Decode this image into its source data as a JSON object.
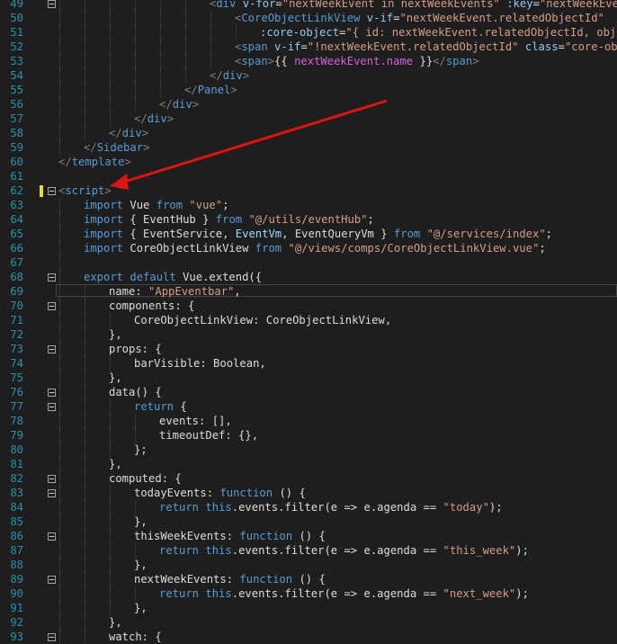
{
  "editor": {
    "language": "vue",
    "modified_line": 62,
    "current_line": 69,
    "lines": [
      {
        "n": "49",
        "fold": true,
        "indent": 170,
        "tokens": [
          [
            "t-br",
            "<"
          ],
          [
            "t-tag",
            "div "
          ],
          [
            "t-attr",
            "v-for"
          ],
          [
            "t-txt",
            "="
          ],
          [
            "t-str",
            "\"nextWeekEvent in nextWeekEvents\""
          ],
          [
            "t-attr",
            " :key"
          ],
          [
            "t-txt",
            "="
          ],
          [
            "t-str",
            "\"nextWeekEvent."
          ]
        ]
      },
      {
        "n": "50",
        "fold": false,
        "indent": 198,
        "tokens": [
          [
            "t-br",
            "<"
          ],
          [
            "t-tag",
            "CoreObjectLinkView "
          ],
          [
            "t-attr",
            "v-if"
          ],
          [
            "t-txt",
            "="
          ],
          [
            "t-str",
            "\"nextWeekEvent.relatedObjectId\""
          ]
        ]
      },
      {
        "n": "51",
        "fold": false,
        "indent": 226,
        "tokens": [
          [
            "t-attr",
            ":core-object"
          ],
          [
            "t-txt",
            "="
          ],
          [
            "t-str",
            "\"{ id: nextWeekEvent.relatedObjectId, object"
          ]
        ]
      },
      {
        "n": "52",
        "fold": false,
        "indent": 198,
        "tokens": [
          [
            "t-br",
            "<"
          ],
          [
            "t-tag",
            "span "
          ],
          [
            "t-attr",
            "v-if"
          ],
          [
            "t-txt",
            "="
          ],
          [
            "t-str",
            "\"!nextWeekEvent.relatedObjectId\""
          ],
          [
            "t-attr",
            " class"
          ],
          [
            "t-txt",
            "="
          ],
          [
            "t-str",
            "\"core-object"
          ]
        ]
      },
      {
        "n": "53",
        "fold": false,
        "indent": 198,
        "tokens": [
          [
            "t-br",
            "<"
          ],
          [
            "t-tag",
            "span"
          ],
          [
            "t-br",
            ">"
          ],
          [
            "t-txt",
            "{{ "
          ],
          [
            "t-mag",
            "nextWeekEvent.name"
          ],
          [
            "t-txt",
            " }}"
          ],
          [
            "t-br",
            "</"
          ],
          [
            "t-tag",
            "span"
          ],
          [
            "t-br",
            ">"
          ]
        ]
      },
      {
        "n": "54",
        "fold": false,
        "indent": 170,
        "tokens": [
          [
            "t-br",
            "</"
          ],
          [
            "t-tag",
            "div"
          ],
          [
            "t-br",
            ">"
          ]
        ]
      },
      {
        "n": "55",
        "fold": false,
        "indent": 142,
        "tokens": [
          [
            "t-br",
            "</"
          ],
          [
            "t-tag",
            "Panel"
          ],
          [
            "t-br",
            ">"
          ]
        ]
      },
      {
        "n": "56",
        "fold": false,
        "indent": 114,
        "tokens": [
          [
            "t-br",
            "</"
          ],
          [
            "t-tag",
            "div"
          ],
          [
            "t-br",
            ">"
          ]
        ]
      },
      {
        "n": "57",
        "fold": false,
        "indent": 86,
        "tokens": [
          [
            "t-br",
            "</"
          ],
          [
            "t-tag",
            "div"
          ],
          [
            "t-br",
            ">"
          ]
        ]
      },
      {
        "n": "58",
        "fold": false,
        "indent": 58,
        "tokens": [
          [
            "t-br",
            "</"
          ],
          [
            "t-tag",
            "div"
          ],
          [
            "t-br",
            ">"
          ]
        ]
      },
      {
        "n": "59",
        "fold": false,
        "indent": 30,
        "tokens": [
          [
            "t-br",
            "</"
          ],
          [
            "t-tag",
            "Sidebar"
          ],
          [
            "t-br",
            ">"
          ]
        ]
      },
      {
        "n": "60",
        "fold": false,
        "indent": 2,
        "tokens": [
          [
            "t-br",
            "</"
          ],
          [
            "t-tag",
            "template"
          ],
          [
            "t-br",
            ">"
          ]
        ]
      },
      {
        "n": "61",
        "fold": false,
        "indent": 2,
        "tokens": []
      },
      {
        "n": "62",
        "fold": true,
        "indent": 2,
        "tokens": [
          [
            "t-br",
            "<"
          ],
          [
            "t-tag",
            "script"
          ],
          [
            "t-br",
            ">"
          ]
        ]
      },
      {
        "n": "63",
        "fold": false,
        "indent": 30,
        "tokens": [
          [
            "t-kw",
            "import "
          ],
          [
            "t-txt",
            "Vue "
          ],
          [
            "t-kw",
            "from "
          ],
          [
            "t-str",
            "\"vue\""
          ],
          [
            "t-txt",
            ";"
          ]
        ]
      },
      {
        "n": "64",
        "fold": false,
        "indent": 30,
        "tokens": [
          [
            "t-kw",
            "import "
          ],
          [
            "t-txt",
            "{ EventHub } "
          ],
          [
            "t-kw",
            "from "
          ],
          [
            "t-str",
            "\"@/utils/eventHub\""
          ],
          [
            "t-txt",
            ";"
          ]
        ]
      },
      {
        "n": "65",
        "fold": false,
        "indent": 30,
        "tokens": [
          [
            "t-kw",
            "import "
          ],
          [
            "t-txt",
            "{ EventService, "
          ],
          [
            "t-dim",
            "EventVm"
          ],
          [
            "t-txt",
            ", EventQueryVm } "
          ],
          [
            "t-kw",
            "from "
          ],
          [
            "t-str",
            "\"@/services/index\""
          ],
          [
            "t-txt",
            ";"
          ]
        ]
      },
      {
        "n": "66",
        "fold": false,
        "indent": 30,
        "tokens": [
          [
            "t-kw",
            "import "
          ],
          [
            "t-txt",
            "CoreObjectLinkView "
          ],
          [
            "t-kw",
            "from "
          ],
          [
            "t-str",
            "\"@/views/comps/CoreObjectLinkView.vue\""
          ],
          [
            "t-txt",
            ";"
          ]
        ]
      },
      {
        "n": "67",
        "fold": false,
        "indent": 30,
        "tokens": []
      },
      {
        "n": "68",
        "fold": true,
        "indent": 30,
        "tokens": [
          [
            "t-kw",
            "export default "
          ],
          [
            "t-txt",
            "Vue.extend({"
          ]
        ]
      },
      {
        "n": "69",
        "fold": false,
        "indent": 58,
        "tokens": [
          [
            "t-txt",
            "name: "
          ],
          [
            "t-str",
            "\"AppEventbar\""
          ],
          [
            "t-txt",
            ","
          ]
        ]
      },
      {
        "n": "70",
        "fold": true,
        "indent": 58,
        "tokens": [
          [
            "t-txt",
            "components: {"
          ]
        ]
      },
      {
        "n": "71",
        "fold": false,
        "indent": 86,
        "tokens": [
          [
            "t-txt",
            "CoreObjectLinkView: CoreObjectLinkView,"
          ]
        ]
      },
      {
        "n": "72",
        "fold": false,
        "indent": 58,
        "tokens": [
          [
            "t-txt",
            "},"
          ]
        ]
      },
      {
        "n": "73",
        "fold": true,
        "indent": 58,
        "tokens": [
          [
            "t-txt",
            "props: {"
          ]
        ]
      },
      {
        "n": "74",
        "fold": false,
        "indent": 86,
        "tokens": [
          [
            "t-txt",
            "barVisible: Boolean,"
          ]
        ]
      },
      {
        "n": "75",
        "fold": false,
        "indent": 58,
        "tokens": [
          [
            "t-txt",
            "},"
          ]
        ]
      },
      {
        "n": "76",
        "fold": true,
        "indent": 58,
        "tokens": [
          [
            "t-txt",
            "data() {"
          ]
        ]
      },
      {
        "n": "77",
        "fold": true,
        "indent": 86,
        "tokens": [
          [
            "t-kw",
            "return "
          ],
          [
            "t-txt",
            "{"
          ]
        ]
      },
      {
        "n": "78",
        "fold": false,
        "indent": 114,
        "tokens": [
          [
            "t-txt",
            "events: [],"
          ]
        ]
      },
      {
        "n": "79",
        "fold": false,
        "indent": 114,
        "tokens": [
          [
            "t-txt",
            "timeoutDef: {},"
          ]
        ]
      },
      {
        "n": "80",
        "fold": false,
        "indent": 86,
        "tokens": [
          [
            "t-txt",
            "};"
          ]
        ]
      },
      {
        "n": "81",
        "fold": false,
        "indent": 58,
        "tokens": [
          [
            "t-txt",
            "},"
          ]
        ]
      },
      {
        "n": "82",
        "fold": true,
        "indent": 58,
        "tokens": [
          [
            "t-txt",
            "computed: {"
          ]
        ]
      },
      {
        "n": "83",
        "fold": true,
        "indent": 86,
        "tokens": [
          [
            "t-txt",
            "todayEvents: "
          ],
          [
            "t-kw",
            "function "
          ],
          [
            "t-txt",
            "() {"
          ]
        ]
      },
      {
        "n": "84",
        "fold": false,
        "indent": 114,
        "tokens": [
          [
            "t-kw",
            "return "
          ],
          [
            "t-kw",
            "this"
          ],
          [
            "t-txt",
            ".events.filter(e => e.agenda == "
          ],
          [
            "t-str",
            "\"today\""
          ],
          [
            "t-txt",
            ");"
          ]
        ]
      },
      {
        "n": "85",
        "fold": false,
        "indent": 86,
        "tokens": [
          [
            "t-txt",
            "},"
          ]
        ]
      },
      {
        "n": "86",
        "fold": true,
        "indent": 86,
        "tokens": [
          [
            "t-txt",
            "thisWeekEvents: "
          ],
          [
            "t-kw",
            "function "
          ],
          [
            "t-txt",
            "() {"
          ]
        ]
      },
      {
        "n": "87",
        "fold": false,
        "indent": 114,
        "tokens": [
          [
            "t-kw",
            "return "
          ],
          [
            "t-kw",
            "this"
          ],
          [
            "t-txt",
            ".events.filter(e => e.agenda == "
          ],
          [
            "t-str",
            "\"this_week\""
          ],
          [
            "t-txt",
            ");"
          ]
        ]
      },
      {
        "n": "88",
        "fold": false,
        "indent": 86,
        "tokens": [
          [
            "t-txt",
            "},"
          ]
        ]
      },
      {
        "n": "89",
        "fold": true,
        "indent": 86,
        "tokens": [
          [
            "t-txt",
            "nextWeekEvents: "
          ],
          [
            "t-kw",
            "function "
          ],
          [
            "t-txt",
            "() {"
          ]
        ]
      },
      {
        "n": "90",
        "fold": false,
        "indent": 114,
        "tokens": [
          [
            "t-kw",
            "return "
          ],
          [
            "t-kw",
            "this"
          ],
          [
            "t-txt",
            ".events.filter(e => e.agenda == "
          ],
          [
            "t-str",
            "\"next_week\""
          ],
          [
            "t-txt",
            ");"
          ]
        ]
      },
      {
        "n": "91",
        "fold": false,
        "indent": 86,
        "tokens": [
          [
            "t-txt",
            "},"
          ]
        ]
      },
      {
        "n": "92",
        "fold": false,
        "indent": 58,
        "tokens": [
          [
            "t-txt",
            "},"
          ]
        ]
      },
      {
        "n": "93",
        "fold": true,
        "indent": 58,
        "tokens": [
          [
            "t-txt",
            "watch: {"
          ]
        ]
      }
    ]
  },
  "annotation": {
    "arrow_color": "#e0140f"
  }
}
